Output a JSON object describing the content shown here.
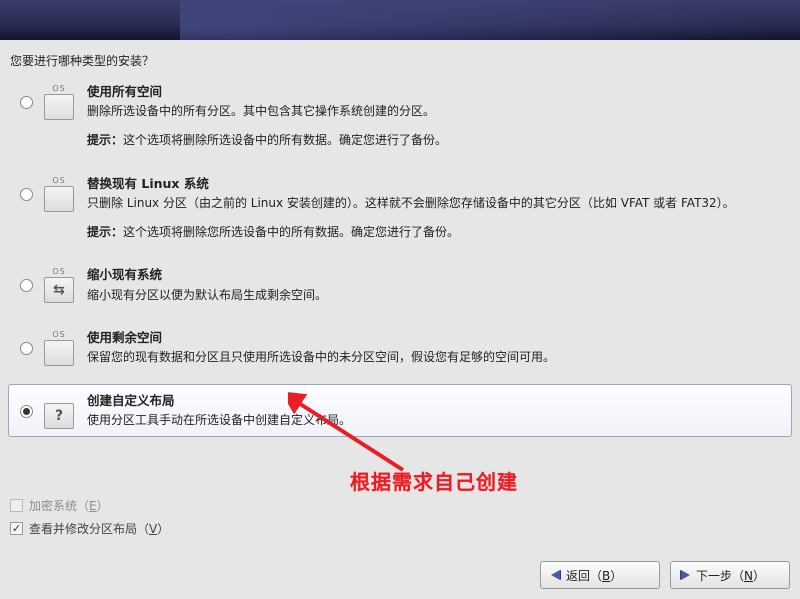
{
  "prompt": "您要进行哪种类型的安装？",
  "options": [
    {
      "title": "使用所有空间",
      "desc1": "删除所选设备中的所有分区。其中包含其它操作系统创建的分区。",
      "hint_label": "提示：",
      "hint_text": "这个选项将删除所选设备中的所有数据。确定您进行了备份。",
      "os_tag": "OS",
      "glyph": "",
      "selected": false
    },
    {
      "title": "替换现有 Linux 系统",
      "desc1": "只删除 Linux 分区（由之前的 Linux 安装创建的）。这样就不会删除您存储设备中的其它分区（比如 VFAT 或者 FAT32）。",
      "hint_label": "提示：",
      "hint_text": "这个选项将删除您所选设备中的所有数据。确定您进行了备份。",
      "os_tag": "OS",
      "glyph": "",
      "selected": false
    },
    {
      "title": "缩小现有系统",
      "desc1": "缩小现有分区以便为默认布局生成剩余空间。",
      "os_tag": "OS",
      "glyph": "⇆",
      "selected": false
    },
    {
      "title": "使用剩余空间",
      "desc1": "保留您的现有数据和分区且只使用所选设备中的未分区空间，假设您有足够的空间可用。",
      "os_tag": "OS",
      "glyph": "",
      "selected": false
    },
    {
      "title": "创建自定义布局",
      "desc1": "使用分区工具手动在所选设备中创建自定义布局。",
      "os_tag": "",
      "glyph": "?",
      "selected": true
    }
  ],
  "checks": {
    "encrypt_label_pre": "加密系统（",
    "encrypt_u": "E",
    "encrypt_label_post": "）",
    "review_label_pre": "查看并修改分区布局（",
    "review_u": "V",
    "review_label_post": "）",
    "review_checked": true,
    "encrypt_checked": false
  },
  "buttons": {
    "back_pre": "返回（",
    "back_u": "B",
    "back_post": "）",
    "next_pre": "下一步（",
    "next_u": "N",
    "next_post": "）"
  },
  "annotation": "根据需求自己创建"
}
